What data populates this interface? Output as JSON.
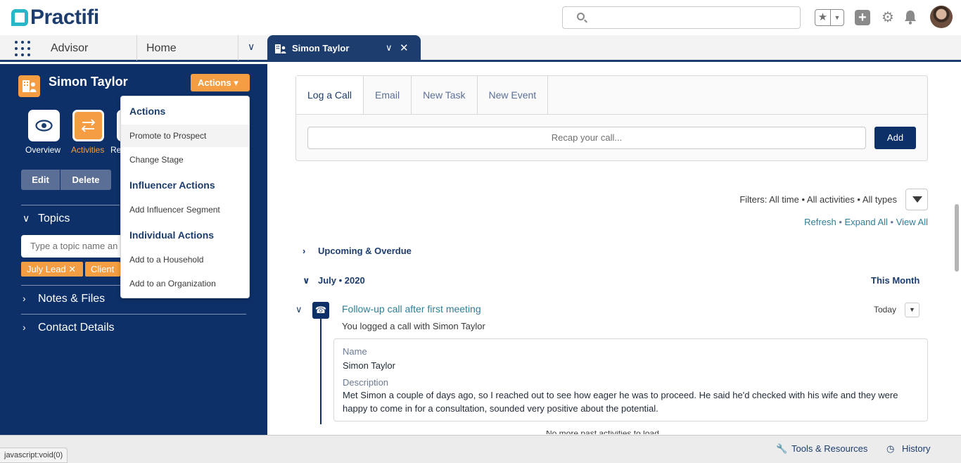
{
  "app": {
    "logo_text": "Practifi",
    "nav_app": "Advisor"
  },
  "header": {
    "search_placeholder": "",
    "favorites_icon": "star-icon"
  },
  "nav": {
    "home": "Home",
    "active_tab": "Simon Taylor"
  },
  "record": {
    "name": "Simon Taylor",
    "actions_label": "Actions",
    "tiles": [
      {
        "label": "Overview"
      },
      {
        "label": "Activities"
      },
      {
        "label": "Re"
      }
    ],
    "edit_label": "Edit",
    "delete_label": "Delete"
  },
  "sections": {
    "topics": "Topics",
    "topic_placeholder": "Type a topic name an",
    "pills": [
      "July Lead",
      "Client"
    ],
    "notes": "Notes & Files",
    "contact": "Contact Details"
  },
  "menu": {
    "groups": [
      {
        "title": "Actions",
        "items": [
          "Promote to Prospect",
          "Change Stage"
        ]
      },
      {
        "title": "Influencer Actions",
        "items": [
          "Add Influencer Segment"
        ]
      },
      {
        "title": "Individual Actions",
        "items": [
          "Add to a Household",
          "Add to an Organization"
        ]
      }
    ]
  },
  "composer": {
    "tabs": [
      "Log a Call",
      "Email",
      "New Task",
      "New Event"
    ],
    "placeholder": "Recap your call...",
    "add_label": "Add"
  },
  "filters": {
    "text": "Filters: All time • All activities • All types",
    "refresh": "Refresh",
    "expand": "Expand All",
    "view": "View All",
    "sep": " • "
  },
  "timeline": {
    "upcoming": "Upcoming & Overdue",
    "month": "July • 2020",
    "this_month": "This Month",
    "item": {
      "title": "Follow-up call after first meeting",
      "date": "Today",
      "subtitle": "You logged a call with Simon Taylor",
      "name_label": "Name",
      "name_value": "Simon Taylor",
      "desc_label": "Description",
      "desc_value": "Met Simon a couple of days ago, so I reached out to see how eager he was to proceed. He said he'd checked with his wife and they were happy to come in for a consultation, sounded very positive about the potential."
    },
    "more": "No more past activities to load."
  },
  "footer": {
    "status_url": "javascript:void(0)",
    "tools": "Tools & Resources",
    "history": "History"
  }
}
